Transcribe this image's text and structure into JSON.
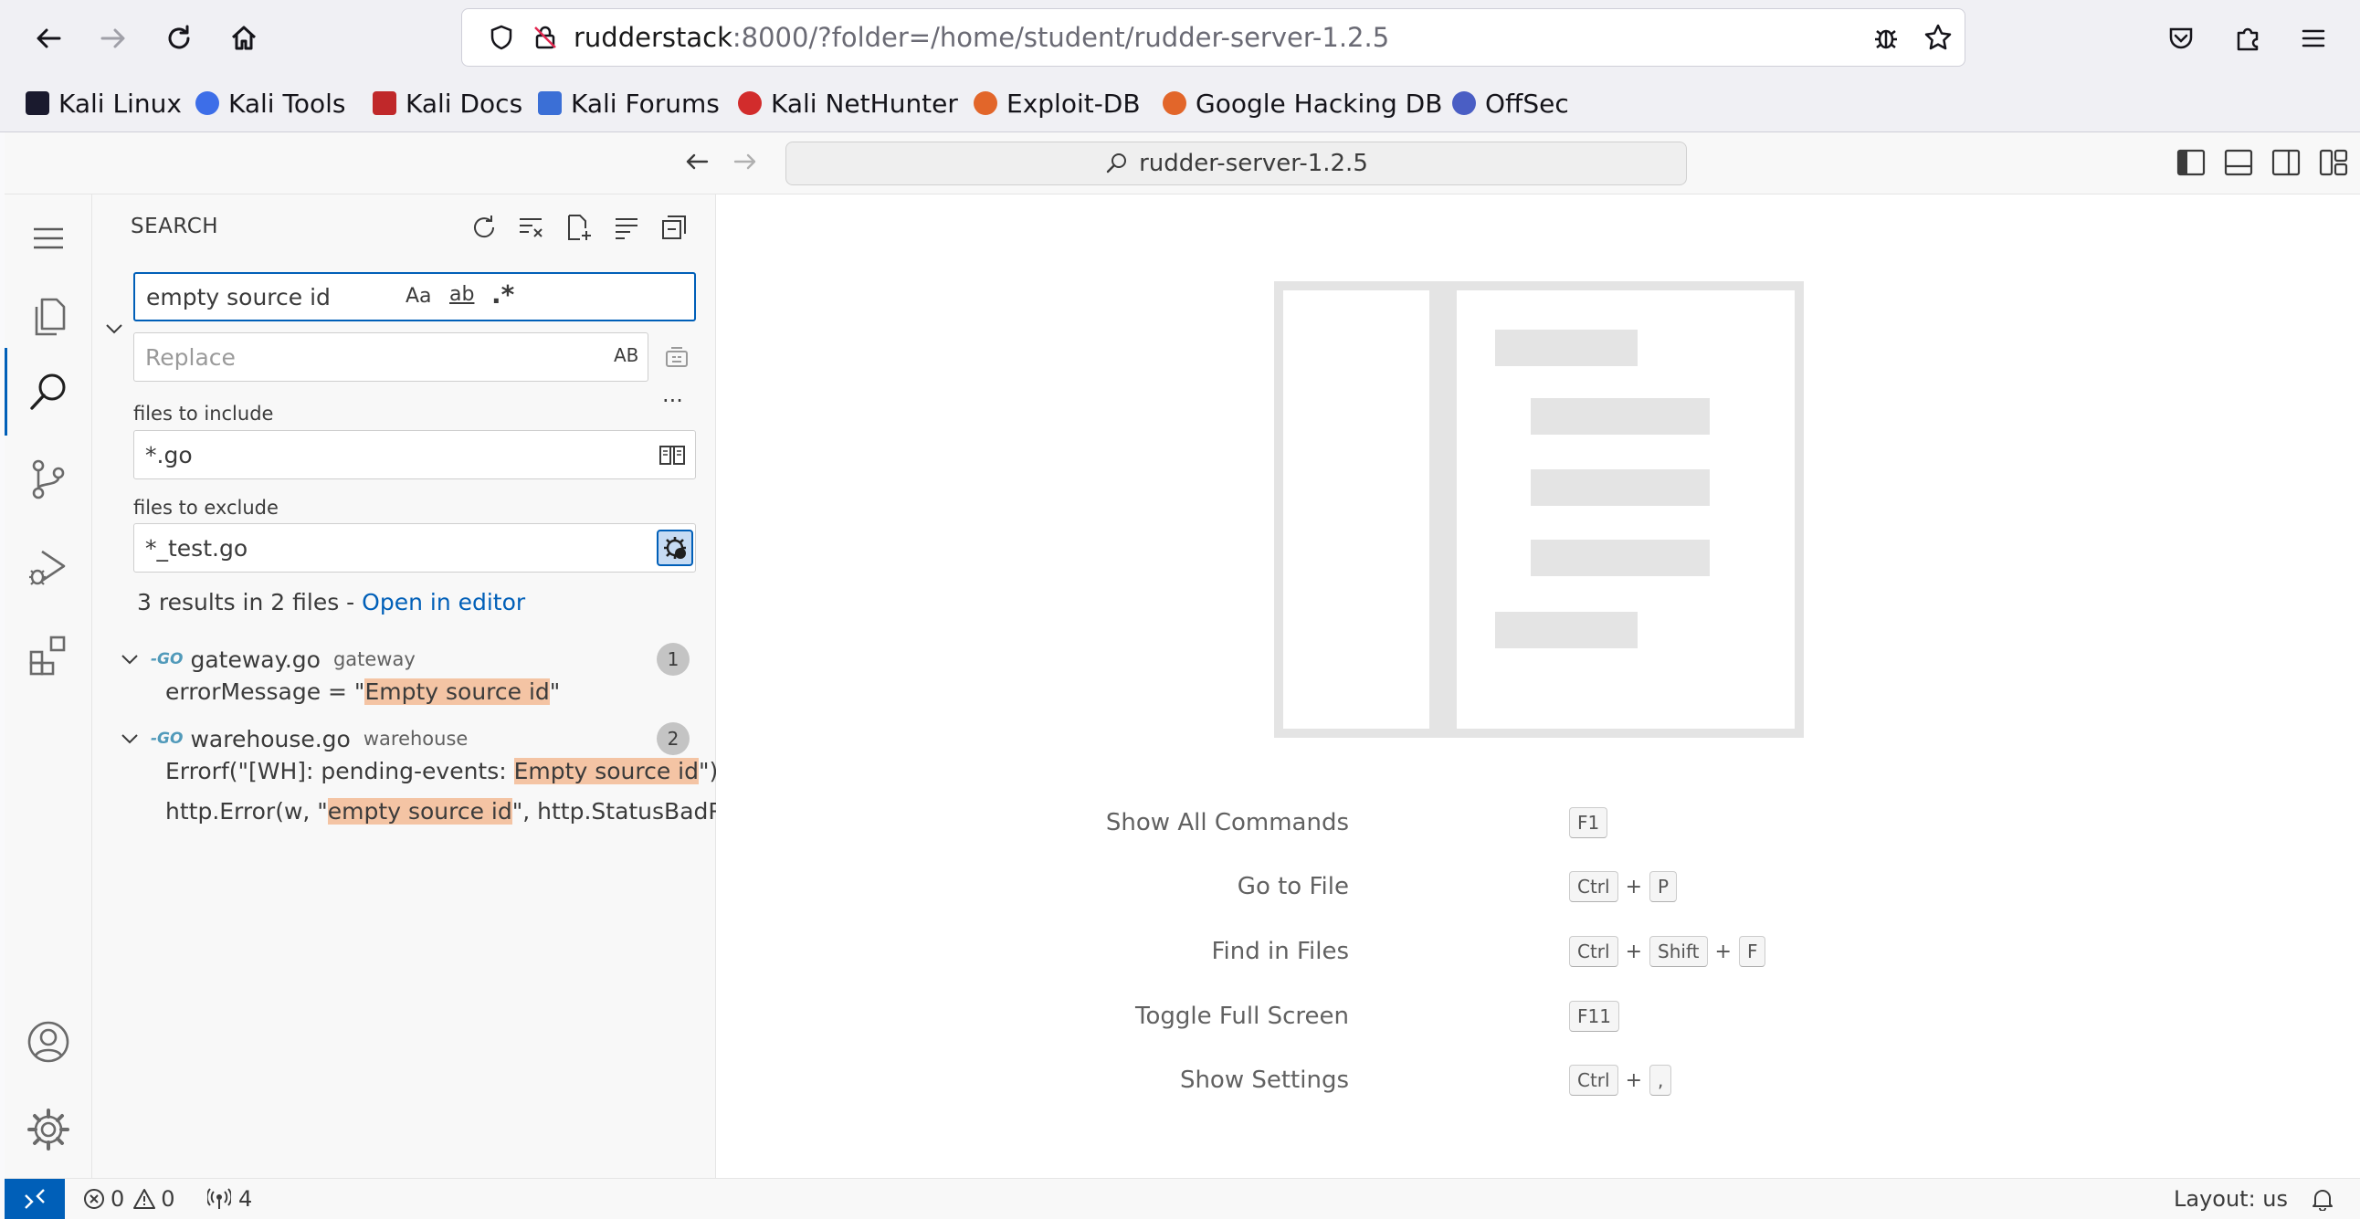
{
  "browser": {
    "url_host": "rudderstack",
    "url_rest": ":8000/?folder=/home/student/rudder-server-1.2.5",
    "bookmarks": [
      "Kali Linux",
      "Kali Tools",
      "Kali Docs",
      "Kali Forums",
      "Kali NetHunter",
      "Exploit-DB",
      "Google Hacking DB",
      "OffSec"
    ]
  },
  "titlebar": {
    "command_center": "rudder-server-1.2.5"
  },
  "search": {
    "title": "SEARCH",
    "query": "empty source id",
    "replace_placeholder": "Replace",
    "match_case": "Aa",
    "whole_word": "ab",
    "regex": ".*",
    "preserve_case": "AB",
    "include_label": "files to include",
    "include_value": "*.go",
    "exclude_label": "files to exclude",
    "exclude_value": "*_test.go",
    "summary": "3 results in 2 files - ",
    "open_in_editor": "Open in editor",
    "files": [
      {
        "name": "gateway.go",
        "dir": "gateway",
        "count": "1",
        "matches": [
          {
            "pre": "errorMessage = \"",
            "match": "Empty source id",
            "post": "\""
          }
        ]
      },
      {
        "name": "warehouse.go",
        "dir": "warehouse",
        "count": "2",
        "matches": [
          {
            "pre": "Errorf(\"[WH]: pending-events:  ",
            "match": "Empty source id",
            "post": "\")"
          },
          {
            "pre": "http.Error(w, \"",
            "match": "empty source id",
            "post": "\", http.StatusBadRe…"
          }
        ]
      }
    ]
  },
  "welcome": {
    "hints": [
      {
        "label": "Show All Commands",
        "keys": [
          "F1"
        ]
      },
      {
        "label": "Go to File",
        "keys": [
          "Ctrl",
          "P"
        ]
      },
      {
        "label": "Find in Files",
        "keys": [
          "Ctrl",
          "Shift",
          "F"
        ]
      },
      {
        "label": "Toggle Full Screen",
        "keys": [
          "F11"
        ]
      },
      {
        "label": "Show Settings",
        "keys": [
          "Ctrl",
          ","
        ]
      }
    ]
  },
  "status": {
    "errors": "0",
    "warnings": "0",
    "ports": "4",
    "layout": "Layout: us"
  },
  "colors": {
    "accent": "#005fb8",
    "match_highlight": "#f4c4a4",
    "remote_indicator": "#005fb8"
  }
}
